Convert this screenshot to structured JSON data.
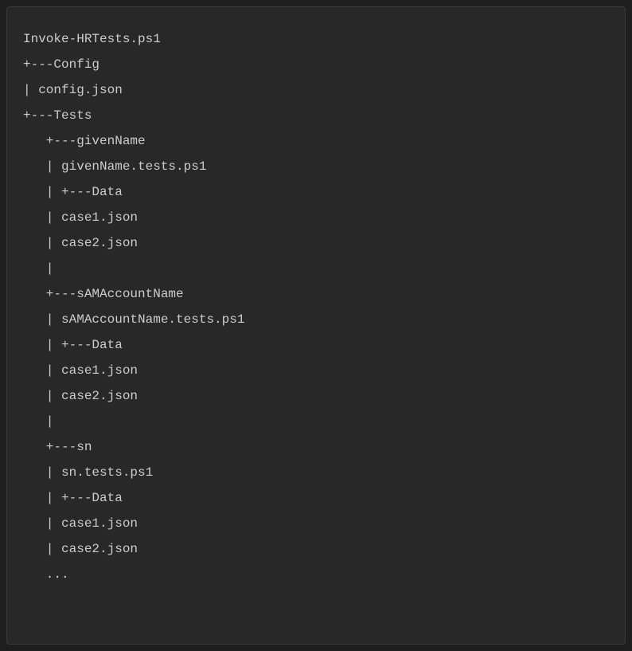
{
  "lines": [
    "Invoke-HRTests.ps1",
    "+---Config",
    "| config.json",
    "+---Tests",
    "   +---givenName",
    "   | givenName.tests.ps1",
    "   | +---Data",
    "   | case1.json",
    "   | case2.json",
    "   |",
    "   +---sAMAccountName",
    "   | sAMAccountName.tests.ps1",
    "   | +---Data",
    "   | case1.json",
    "   | case2.json",
    "   |",
    "   +---sn",
    "   | sn.tests.ps1",
    "   | +---Data",
    "   | case1.json",
    "   | case2.json",
    "   ..."
  ]
}
